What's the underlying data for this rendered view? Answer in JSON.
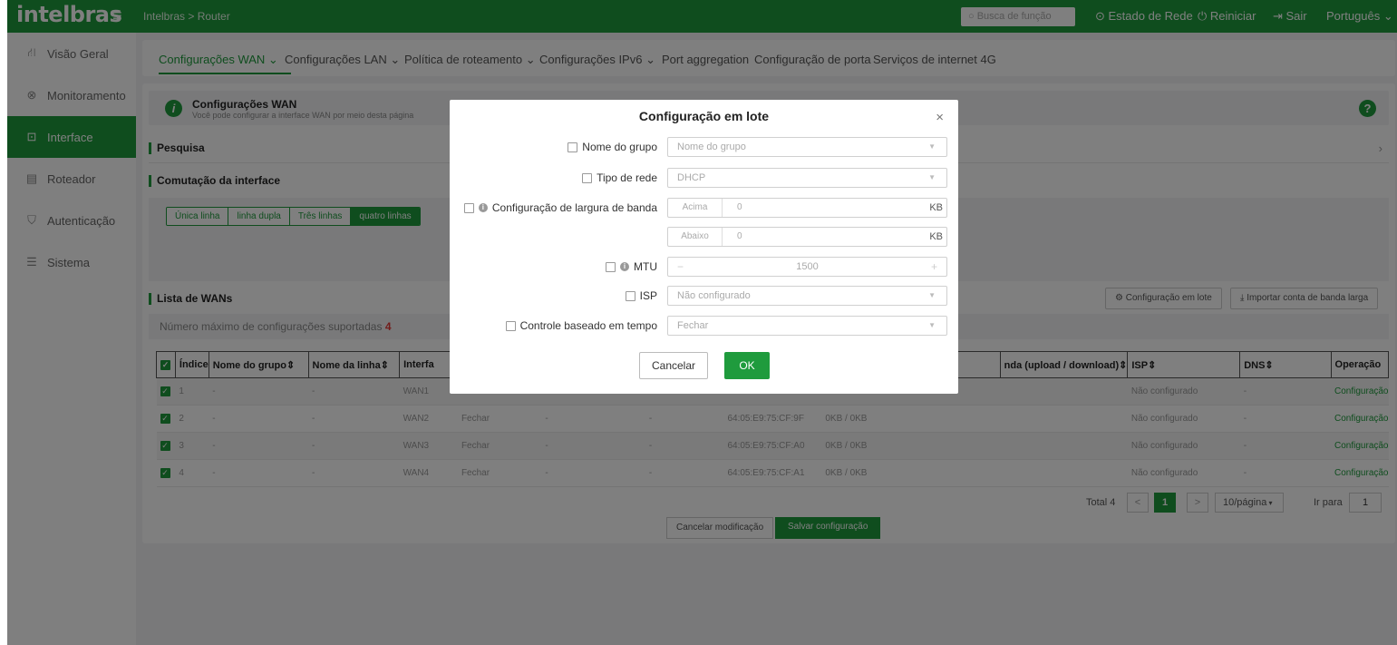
{
  "topbar": {
    "logo": "intelbras",
    "menu_icon": "≡",
    "breadcrumb": "Intelbras > Router",
    "search_placeholder": "Busca de função",
    "network_status": "Estado de Rede",
    "restart": "Reiniciar",
    "logout": "Sair",
    "language": "Português"
  },
  "sidebar": {
    "items": [
      {
        "label": "Visão Geral",
        "icon": "network-icon"
      },
      {
        "label": "Monitoramento",
        "icon": "monitor-icon"
      },
      {
        "label": "Interface",
        "icon": "interface-icon",
        "active": true
      },
      {
        "label": "Roteador",
        "icon": "router-icon"
      },
      {
        "label": "Autenticação",
        "icon": "shield-icon"
      },
      {
        "label": "Sistema",
        "icon": "settings-icon"
      }
    ]
  },
  "tabs": [
    {
      "label": "Configurações WAN",
      "dropdown": true,
      "active": true
    },
    {
      "label": "Configurações LAN",
      "dropdown": true
    },
    {
      "label": "Política de roteamento",
      "dropdown": true
    },
    {
      "label": "Configurações IPv6",
      "dropdown": true
    },
    {
      "label": "Port aggregation"
    },
    {
      "label": "Configuração de porta"
    },
    {
      "label": "Serviços de internet 4G"
    }
  ],
  "info": {
    "title": "Configurações WAN",
    "description": "Você pode configurar a interface WAN por meio desta página",
    "help": "?"
  },
  "search_section": {
    "title": "Pesquisa"
  },
  "switch_section": {
    "title": "Comutação da interface",
    "options": [
      "Única linha",
      "linha dupla",
      "Três linhas",
      "quatro linhas"
    ],
    "selected": "quatro linhas"
  },
  "wan_list": {
    "title": "Lista de WANs",
    "batch_button": "Configuração em lote",
    "import_button": "Importar conta de banda larga",
    "max_label": "Número máximo de configurações suportadas",
    "max_value": "4",
    "columns": [
      "Índice",
      "Nome do grupo",
      "Nome da linha",
      "Interfa",
      "",
      "",
      "",
      "",
      "",
      "nda (upload / download)",
      "ISP",
      "DNS",
      "Operação"
    ],
    "rows": [
      [
        "1",
        "-",
        "-",
        "WAN1",
        "",
        "",
        "",
        "",
        "",
        "",
        "Não configurado",
        "-",
        "Configuração"
      ],
      [
        "2",
        "-",
        "-",
        "WAN2",
        "Fechar",
        "-",
        "-",
        "64:05:E9:75:CF:9F",
        "0KB / 0KB",
        "",
        "Não configurado",
        "-",
        "Configuração"
      ],
      [
        "3",
        "-",
        "-",
        "WAN3",
        "Fechar",
        "-",
        "-",
        "64:05:E9:75:CF:A0",
        "0KB / 0KB",
        "",
        "Não configurado",
        "-",
        "Configuração"
      ],
      [
        "4",
        "-",
        "-",
        "WAN4",
        "Fechar",
        "-",
        "-",
        "64:05:E9:75:CF:A1",
        "0KB / 0KB",
        "",
        "Não configurado",
        "-",
        "Configuração"
      ]
    ]
  },
  "pagination": {
    "total": "Total 4",
    "prev": "<",
    "current": "1",
    "next": ">",
    "page_size": "10/página",
    "goto_label": "Ir para",
    "goto_value": "1"
  },
  "footer_buttons": {
    "cancel": "Cancelar modificação",
    "save": "Salvar configuração"
  },
  "modal": {
    "title": "Configuração em lote",
    "close": "×",
    "fields": {
      "group_name": {
        "label": "Nome do grupo",
        "value": "Nome do grupo"
      },
      "network_type": {
        "label": "Tipo de rede",
        "value": "DHCP"
      },
      "bandwidth": {
        "label": "Configuração de largura de banda",
        "up_label": "Acima",
        "up_value": "0",
        "down_label": "Abaixo",
        "down_value": "0",
        "unit": "KB"
      },
      "mtu": {
        "label": "MTU",
        "minus": "−",
        "value": "1500",
        "plus": "+"
      },
      "isp": {
        "label": "ISP",
        "value": "Não configurado"
      },
      "time_control": {
        "label": "Controle baseado em tempo",
        "value": "Fechar"
      }
    },
    "cancel": "Cancelar",
    "ok": "OK"
  },
  "colors": {
    "brand": "#1f9b3d",
    "alert": "#e53935"
  }
}
